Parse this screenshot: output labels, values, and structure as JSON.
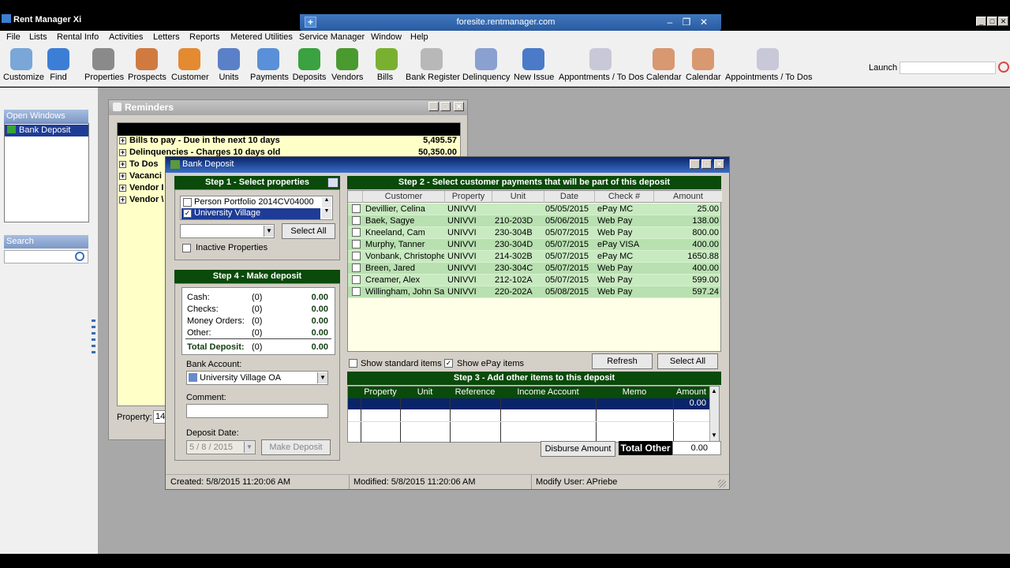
{
  "app": {
    "title": "Rent Manager Xi"
  },
  "remote": {
    "host": "foresite.rentmanager.com",
    "plus": "+",
    "min": "–",
    "restore": "❐",
    "close": "✕"
  },
  "window_controls": {
    "min": "_",
    "max": "□",
    "close": "✕"
  },
  "menu": [
    "File",
    "Lists",
    "Rental Info",
    "Activities",
    "Letters",
    "Reports",
    "Metered Utilities",
    "Service Manager",
    "Window",
    "Help"
  ],
  "toolbar": [
    {
      "label": "Customize",
      "icon": "customize-icon",
      "color": "#7aa6d8"
    },
    {
      "label": "Find",
      "icon": "find-icon",
      "color": "#3c7ed6"
    },
    {
      "label": "Properties",
      "icon": "properties-icon",
      "color": "#8a8a8a"
    },
    {
      "label": "Prospects",
      "icon": "prospects-icon",
      "color": "#d07a40"
    },
    {
      "label": "Customer",
      "icon": "customer-icon",
      "color": "#e48a30"
    },
    {
      "label": "Units",
      "icon": "units-icon",
      "color": "#5a80c8"
    },
    {
      "label": "Payments",
      "icon": "payments-icon",
      "color": "#5a90d8"
    },
    {
      "label": "Deposits",
      "icon": "deposits-icon",
      "color": "#3aa240"
    },
    {
      "label": "Vendors",
      "icon": "vendors-icon",
      "color": "#4a9a30"
    },
    {
      "label": "Bills",
      "icon": "bills-icon",
      "color": "#7ab030"
    },
    {
      "label": "Bank Register",
      "icon": "bank-register-icon",
      "color": "#b8b8b8"
    },
    {
      "label": "Delinquency",
      "icon": "delinquency-icon",
      "color": "#8aa0d0"
    },
    {
      "label": "New Issue",
      "icon": "new-issue-icon",
      "color": "#4a7ac8"
    },
    {
      "label": "Appontments / To Dos",
      "icon": "clock-icon",
      "color": "#c8c8d8"
    },
    {
      "label": "Calendar",
      "icon": "calendar-icon",
      "color": "#d89870"
    },
    {
      "label": "Calendar",
      "icon": "calendar-icon",
      "color": "#d89870"
    },
    {
      "label": "Appointments / To Dos",
      "icon": "clock-icon",
      "color": "#c8c8d8"
    }
  ],
  "launch": {
    "label": "Launch",
    "value": ""
  },
  "left_panel": {
    "open_windows_title": "Open Windows",
    "open_windows_item": "Bank Deposit",
    "search_title": "Search",
    "search_value": ""
  },
  "reminders": {
    "title": "Reminders",
    "rows": [
      {
        "label": "Bills to pay - Due in the next 10 days",
        "value": "5,495.57"
      },
      {
        "label": "Delinquencies - Charges 10 days old",
        "value": "50,350.00"
      },
      {
        "label": "To Dos",
        "value": ""
      },
      {
        "label": "Vacanci",
        "value": ""
      },
      {
        "label": "Vendor I",
        "value": ""
      },
      {
        "label": "Vendor \\",
        "value": ""
      }
    ],
    "property_label": "Property:",
    "property_value": "14"
  },
  "bank_deposit": {
    "title": "Bank Deposit",
    "step1": {
      "title": "Step 1 - Select properties",
      "properties": [
        {
          "label": "Person Portfolio 2014CV04000",
          "checked": false
        },
        {
          "label": "University Village",
          "checked": true
        }
      ],
      "combo_value": "",
      "select_all": "Select All",
      "inactive_label": "Inactive Properties"
    },
    "step2": {
      "title": "Step 2 - Select customer payments that will be part of this deposit",
      "columns": [
        "Customer",
        "Property",
        "Unit",
        "Date",
        "Check #",
        "Amount"
      ],
      "rows": [
        {
          "customer": "Devillier, Celina",
          "property": "UNIVVI",
          "unit": "",
          "date": "05/05/2015",
          "check": "ePay MC",
          "amount": "25.00"
        },
        {
          "customer": "Baek, Sagye",
          "property": "UNIVVI",
          "unit": "210-203D",
          "date": "05/06/2015",
          "check": "Web Pay",
          "amount": "138.00"
        },
        {
          "customer": "Kneeland, Cam",
          "property": "UNIVVI",
          "unit": "230-304B",
          "date": "05/07/2015",
          "check": "Web Pay",
          "amount": "800.00"
        },
        {
          "customer": "Murphy, Tanner",
          "property": "UNIVVI",
          "unit": "230-304D",
          "date": "05/07/2015",
          "check": "ePay VISA",
          "amount": "400.00"
        },
        {
          "customer": "Vonbank, Christopher",
          "property": "UNIVVI",
          "unit": "214-302B",
          "date": "05/07/2015",
          "check": "ePay MC",
          "amount": "1650.88"
        },
        {
          "customer": "Breen, Jared",
          "property": "UNIVVI",
          "unit": "230-304C",
          "date": "05/07/2015",
          "check": "Web Pay",
          "amount": "400.00"
        },
        {
          "customer": "Creamer, Alex",
          "property": "UNIVVI",
          "unit": "212-102A",
          "date": "05/07/2015",
          "check": "Web Pay",
          "amount": "599.00"
        },
        {
          "customer": "Willingham, John Sam",
          "property": "UNIVVI",
          "unit": "220-202A",
          "date": "05/08/2015",
          "check": "Web Pay",
          "amount": "597.24"
        }
      ],
      "show_standard": "Show standard items",
      "show_epay": "Show ePay items",
      "refresh": "Refresh",
      "select_all": "Select All"
    },
    "step3": {
      "title": "Step 3 - Add other items to this deposit",
      "columns": [
        "Property",
        "Unit",
        "Reference",
        "Income Account",
        "Memo",
        "Amount"
      ],
      "first_amount": "0.00",
      "disburse": "Disburse Amount",
      "total_other_label": "Total Other",
      "total_other_value": "0.00"
    },
    "step4": {
      "title": "Step 4 - Make deposit",
      "items": [
        {
          "label": "Cash:",
          "count": "(0)",
          "amount": "0.00"
        },
        {
          "label": "Checks:",
          "count": "(0)",
          "amount": "0.00"
        },
        {
          "label": "Money Orders:",
          "count": "(0)",
          "amount": "0.00"
        },
        {
          "label": "Other:",
          "count": "(0)",
          "amount": "0.00"
        }
      ],
      "total_label": "Total Deposit:",
      "total_count": "(0)",
      "total_amount": "0.00",
      "bank_account_label": "Bank Account:",
      "bank_account_value": "University Village OA",
      "comment_label": "Comment:",
      "comment_value": "",
      "deposit_date_label": "Deposit Date:",
      "deposit_date_value": "5 / 8 / 2015",
      "make_deposit": "Make Deposit"
    },
    "status": {
      "created": "Created: 5/8/2015 11:20:06 AM",
      "modified": "Modified: 5/8/2015 11:20:06 AM",
      "modify_user": "Modify User: APriebe"
    }
  }
}
